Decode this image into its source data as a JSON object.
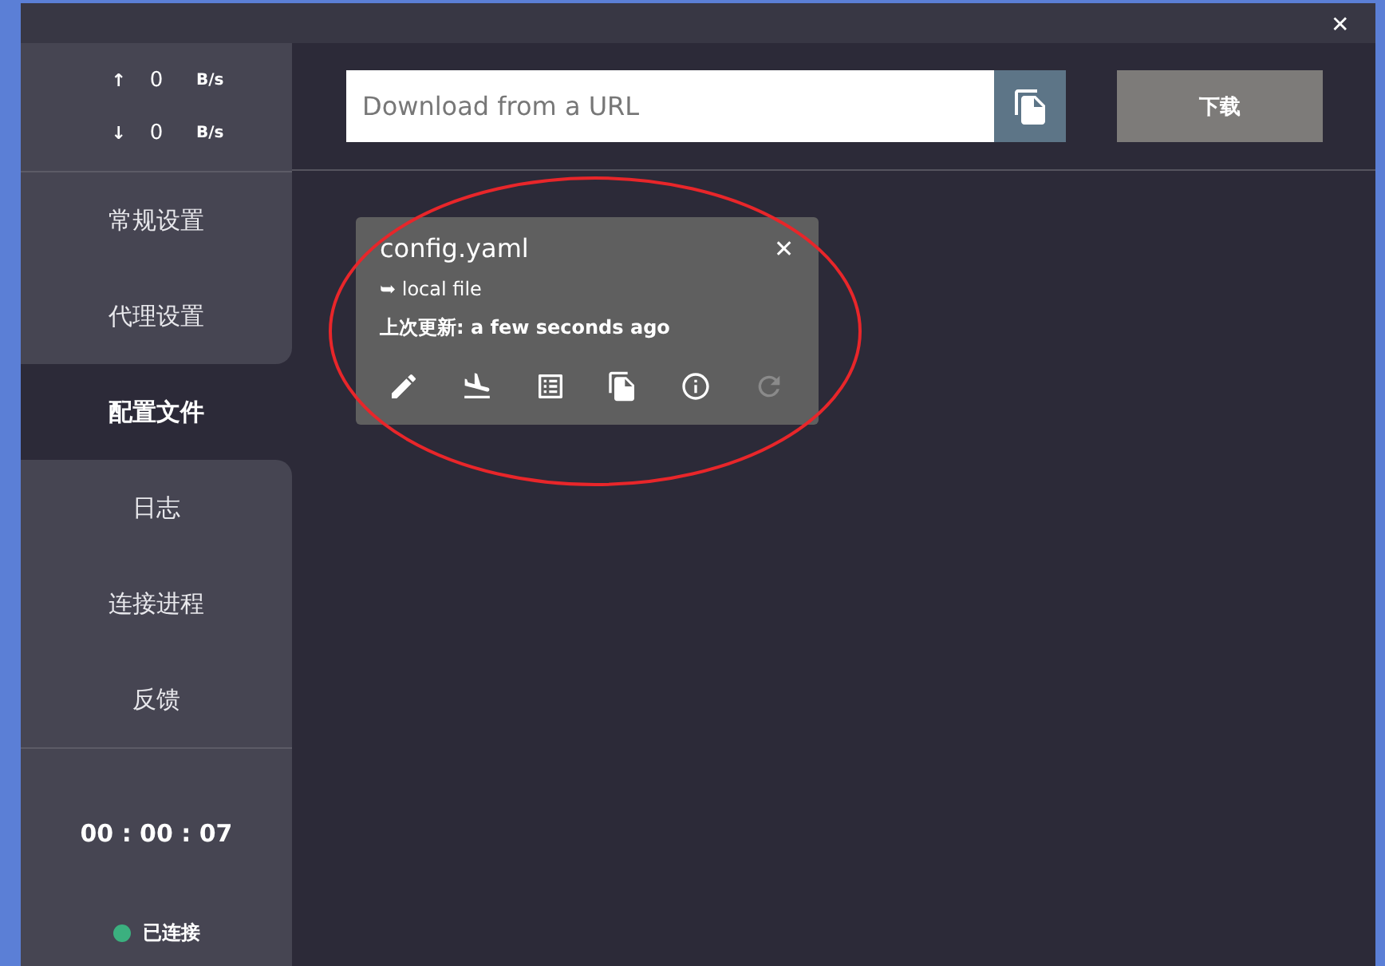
{
  "window": {
    "close": "✕"
  },
  "traffic": [
    {
      "arrow": "↑",
      "value": "0",
      "unit": "B/s"
    },
    {
      "arrow": "↓",
      "value": "0",
      "unit": "B/s"
    }
  ],
  "sidebar": {
    "items": [
      {
        "label": "常规设置",
        "selected": false
      },
      {
        "label": "代理设置",
        "selected": false
      },
      {
        "label": "配置文件",
        "selected": true
      },
      {
        "label": "日志",
        "selected": false
      },
      {
        "label": "连接进程",
        "selected": false
      },
      {
        "label": "反馈",
        "selected": false
      }
    ],
    "timer": "00 : 00 : 07",
    "status": {
      "label": "已连接",
      "color": "#3bb07f"
    }
  },
  "download": {
    "placeholder": "Download from a URL",
    "button": "下载"
  },
  "profiles": [
    {
      "name": "config.yaml",
      "close": "✕",
      "source": "➥ local file",
      "updated": "上次更新: a few seconds ago",
      "actions": [
        {
          "kind": "edit",
          "disabled": false
        },
        {
          "kind": "landing",
          "disabled": false
        },
        {
          "kind": "list",
          "disabled": false
        },
        {
          "kind": "copy",
          "disabled": false
        },
        {
          "kind": "info",
          "disabled": false
        },
        {
          "kind": "refresh",
          "disabled": true
        }
      ]
    }
  ]
}
